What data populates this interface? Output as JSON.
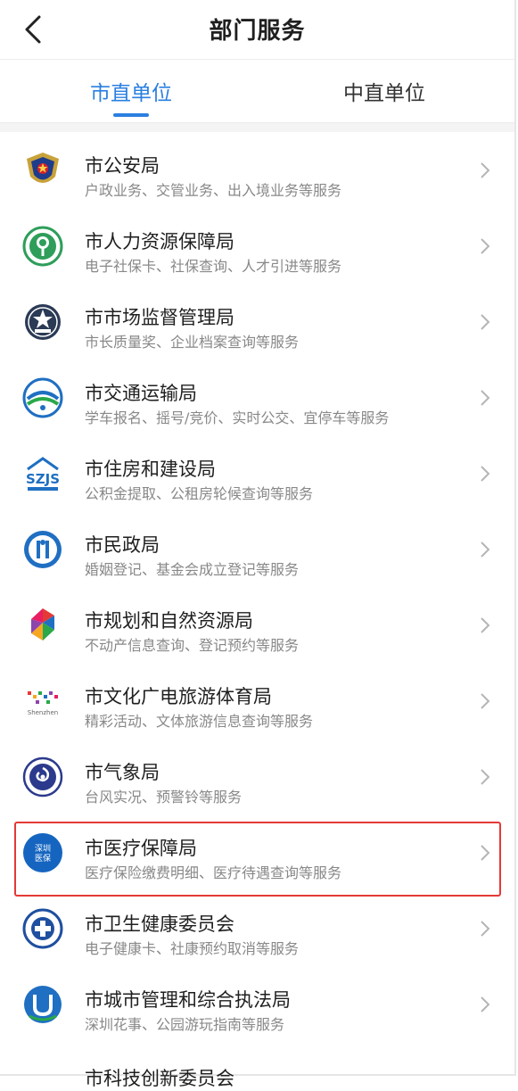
{
  "header": {
    "title": "部门服务"
  },
  "tabs": [
    {
      "label": "市直单位",
      "active": true
    },
    {
      "label": "中直单位",
      "active": false
    }
  ],
  "accent_color": "#2a7fe0",
  "highlight_color": "#e53935",
  "items": [
    {
      "name": "市公安局",
      "desc": "户政业务、交管业务、出入境业务等服务",
      "icon": "police-badge-icon"
    },
    {
      "name": "市人力资源保障局",
      "desc": "电子社保卡、社保查询、人才引进等服务",
      "icon": "tree-emblem-icon"
    },
    {
      "name": "市市场监督管理局",
      "desc": "市长质量奖、企业档案查询等服务",
      "icon": "shield-emblem-icon"
    },
    {
      "name": "市交通运输局",
      "desc": "学车报名、摇号/竞价、实时公交、宜停车等服务",
      "icon": "transport-emblem-icon"
    },
    {
      "name": "市住房和建设局",
      "desc": "公积金提取、公租房轮候查询等服务",
      "icon": "szjs-logo-icon"
    },
    {
      "name": "市民政局",
      "desc": "婚姻登记、基金会成立登记等服务",
      "icon": "civil-affairs-emblem-icon"
    },
    {
      "name": "市规划和自然资源局",
      "desc": "不动产信息查询、登记预约等服务",
      "icon": "planning-logo-icon"
    },
    {
      "name": "市文化广电旅游体育局",
      "desc": "精彩活动、文体旅游信息查询等服务",
      "icon": "shenzhen-culture-logo-icon",
      "icon_caption": "Shenzhen"
    },
    {
      "name": "市气象局",
      "desc": "台风实况、预警铃等服务",
      "icon": "weather-emblem-icon"
    },
    {
      "name": "市医疗保障局",
      "desc": "医疗保险缴费明细、医疗待遇查询等服务",
      "icon": "medical-insurance-logo-icon",
      "icon_text": "深圳医保",
      "highlighted": true
    },
    {
      "name": "市卫生健康委员会",
      "desc": "电子健康卡、社康预约取消等服务",
      "icon": "health-emblem-icon"
    },
    {
      "name": "市城市管理和综合执法局",
      "desc": "深圳花事、公园游玩指南等服务",
      "icon": "urban-management-logo-icon"
    }
  ],
  "partial_item": "市科技创新委员会"
}
